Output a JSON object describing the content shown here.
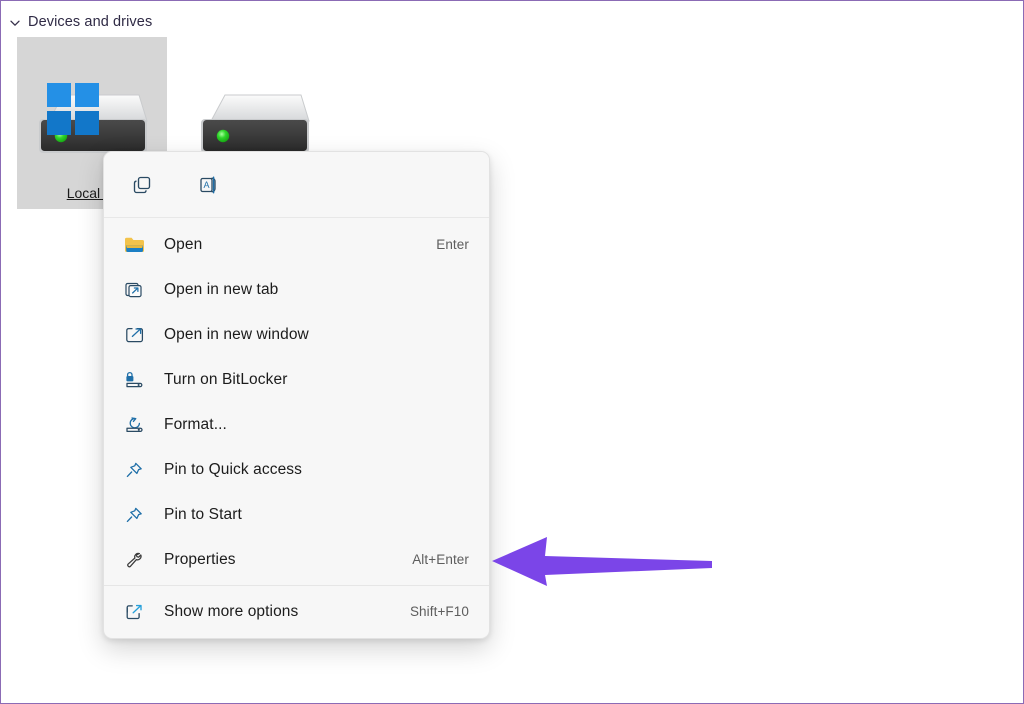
{
  "window": {
    "frame_color": "#8b6bb5",
    "background": "#ffffff"
  },
  "explorer": {
    "group_header": {
      "label": "Devices and drives",
      "chevron_icon": "chevron-down-icon",
      "expanded": true
    },
    "drives": [
      {
        "label": "Local Di",
        "icon": "hard-drive-icon",
        "overlay_icon": "windows-logo-icon",
        "selected": true
      },
      {
        "label": "",
        "icon": "hard-drive-icon",
        "overlay_icon": "",
        "selected": false
      }
    ]
  },
  "context_menu": {
    "header_buttons": [
      {
        "name": "copy-icon",
        "label": "Copy"
      },
      {
        "name": "rename-icon",
        "label": "Rename"
      }
    ],
    "items": [
      {
        "icon": "folder-open-icon",
        "label": "Open",
        "accel": "Enter",
        "separator_after": false
      },
      {
        "icon": "open-new-tab-icon",
        "label": "Open in new tab",
        "accel": "",
        "separator_after": false
      },
      {
        "icon": "open-new-window-icon",
        "label": "Open in new window",
        "accel": "",
        "separator_after": false
      },
      {
        "icon": "bitlocker-icon",
        "label": "Turn on BitLocker",
        "accel": "",
        "separator_after": false
      },
      {
        "icon": "format-drive-icon",
        "label": "Format...",
        "accel": "",
        "separator_after": false
      },
      {
        "icon": "pin-icon",
        "label": "Pin to Quick access",
        "accel": "",
        "separator_after": false
      },
      {
        "icon": "pin-icon",
        "label": "Pin to Start",
        "accel": "",
        "separator_after": false
      },
      {
        "icon": "wrench-icon",
        "label": "Properties",
        "accel": "Alt+Enter",
        "separator_after": true
      },
      {
        "icon": "show-more-options-icon",
        "label": "Show more options",
        "accel": "Shift+F10",
        "separator_after": false
      }
    ]
  },
  "annotation": {
    "arrow": {
      "name": "pointer-arrow",
      "color": "#7b45e8",
      "direction": "left",
      "points_to": "Properties"
    }
  }
}
